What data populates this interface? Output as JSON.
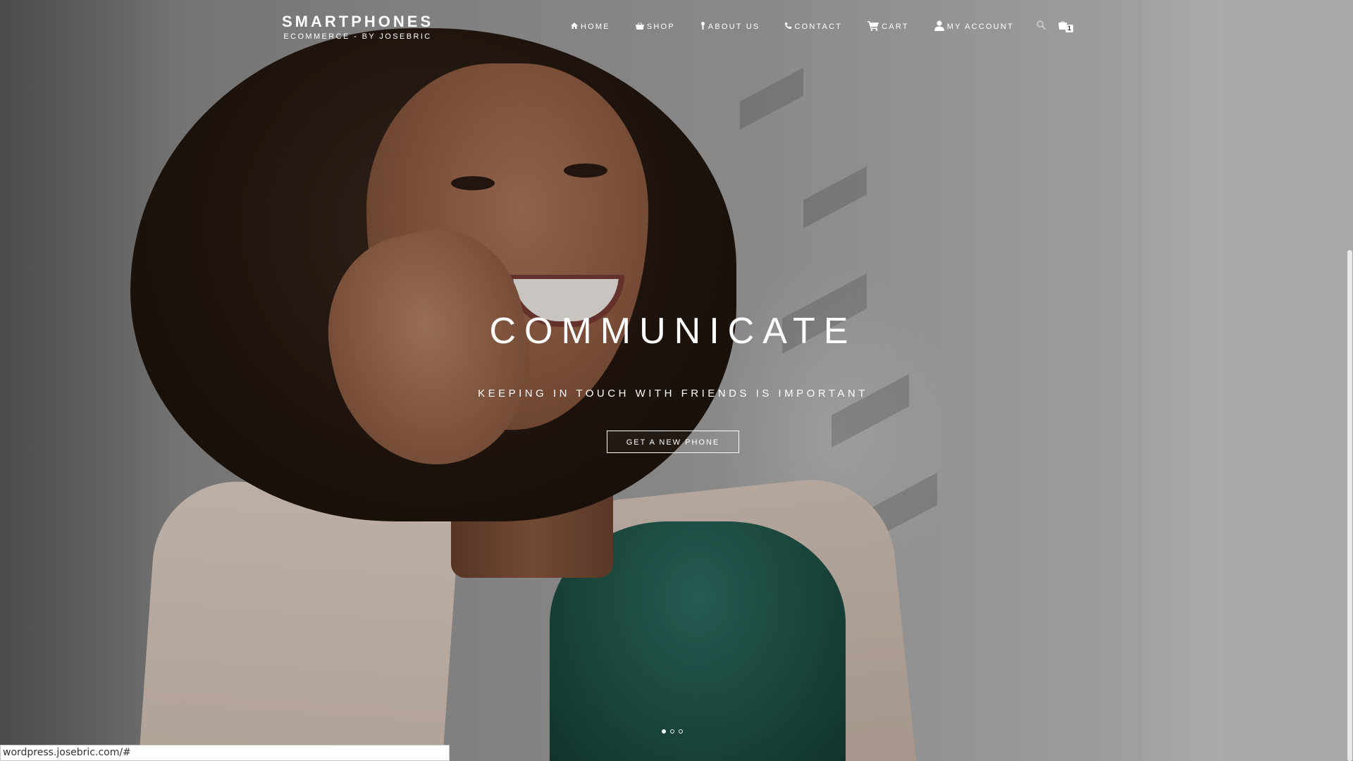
{
  "brand": {
    "title": "SMARTPHONES",
    "subtitle": "ECOMMERCE - BY JOSEBRIC"
  },
  "nav": {
    "items": [
      {
        "label": "HOME",
        "icon": "home-icon"
      },
      {
        "label": "SHOP",
        "icon": "basket-icon"
      },
      {
        "label": "ABOUT US",
        "icon": "pin-icon"
      },
      {
        "label": "CONTACT",
        "icon": "phone-icon"
      },
      {
        "label": "CART",
        "icon": "cart-icon"
      },
      {
        "label": "MY ACCOUNT",
        "icon": "user-icon"
      }
    ],
    "search_icon": "search-icon",
    "mini_cart_icon": "shopping-bag-icon",
    "cart_count": "1"
  },
  "hero": {
    "title": "COMMUNICATE",
    "subtitle": "KEEPING IN TOUCH WITH FRIENDS IS IMPORTANT",
    "button_label": "GET A NEW PHONE"
  },
  "slider": {
    "active_index": 0
  },
  "status_bar": {
    "url": "wordpress.josebric.com/#"
  },
  "colors": {
    "text": "#ffffff",
    "overlay": "#000000",
    "status_bg": "#ffffff"
  }
}
